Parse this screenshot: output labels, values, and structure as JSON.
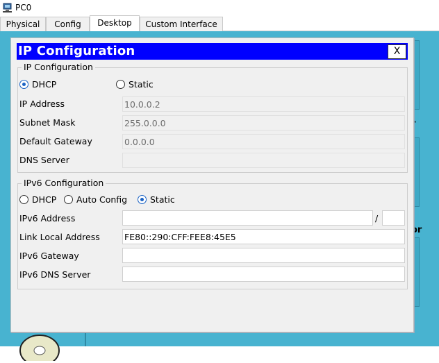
{
  "window": {
    "title": "PC0"
  },
  "tabs": [
    {
      "label": "Physical"
    },
    {
      "label": "Config"
    },
    {
      "label": "Desktop"
    },
    {
      "label": "Custom Interface"
    }
  ],
  "background_fragments": {
    "right_text_1": "r",
    "right_text_2": "or",
    "right_text_3": "l"
  },
  "dialog": {
    "title": "IP Configuration",
    "close_label": "X",
    "ipv4": {
      "legend": "IP Configuration",
      "mode_options": [
        {
          "label": "DHCP",
          "selected": true
        },
        {
          "label": "Static",
          "selected": false
        }
      ],
      "fields": {
        "ip_address": {
          "label": "IP Address",
          "value": "10.0.0.2"
        },
        "subnet_mask": {
          "label": "Subnet Mask",
          "value": "255.0.0.0"
        },
        "default_gateway": {
          "label": "Default Gateway",
          "value": "0.0.0.0"
        },
        "dns_server": {
          "label": "DNS Server",
          "value": ""
        }
      }
    },
    "ipv6": {
      "legend": "IPv6 Configuration",
      "mode_options": [
        {
          "label": "DHCP",
          "selected": false
        },
        {
          "label": "Auto Config",
          "selected": false
        },
        {
          "label": "Static",
          "selected": true
        }
      ],
      "fields": {
        "ipv6_address": {
          "label": "IPv6 Address",
          "value": "",
          "prefix_separator": "/",
          "prefix": ""
        },
        "link_local": {
          "label": "Link Local Address",
          "value": "FE80::290:CFF:FEE8:45E5"
        },
        "ipv6_gateway": {
          "label": "IPv6 Gateway",
          "value": ""
        },
        "ipv6_dns": {
          "label": "IPv6 DNS Server",
          "value": ""
        }
      }
    }
  },
  "colors": {
    "header_blue": "#0000ff",
    "desktop_cyan": "#48b3d0",
    "radio_blue": "#1a62c4"
  }
}
